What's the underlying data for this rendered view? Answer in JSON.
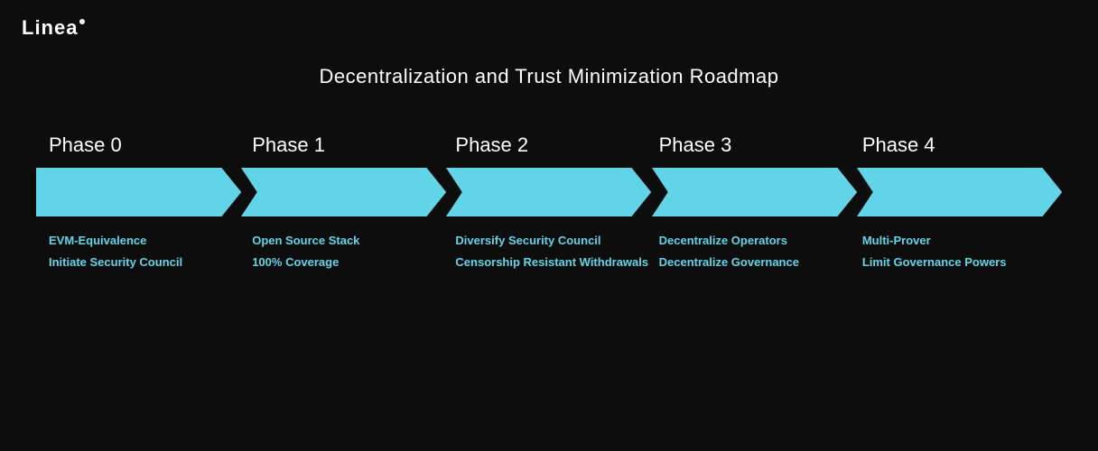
{
  "header": {
    "logo_text": "Linea",
    "logo_dot": "·"
  },
  "page": {
    "title": "Decentralization and Trust Minimization Roadmap"
  },
  "phases": [
    {
      "id": "phase-0",
      "label": "Phase 0",
      "details": [
        "EVM-Equivalence",
        "Initiate Security Council"
      ]
    },
    {
      "id": "phase-1",
      "label": "Phase 1",
      "details": [
        "Open Source Stack",
        "100% Coverage"
      ]
    },
    {
      "id": "phase-2",
      "label": "Phase 2",
      "details": [
        "Diversify Security Council",
        "Censorship Resistant Withdrawals"
      ]
    },
    {
      "id": "phase-3",
      "label": "Phase 3",
      "details": [
        "Decentralize Operators",
        "Decentralize Governance"
      ]
    },
    {
      "id": "phase-4",
      "label": "Phase 4",
      "details": [
        "Multi-Prover",
        "Limit Governance Powers"
      ]
    }
  ],
  "colors": {
    "arrow_fill": "#61d4e8",
    "arrow_dark": "#0d0d0d",
    "text_accent": "#61d4e8",
    "background": "#0d0d0d"
  }
}
